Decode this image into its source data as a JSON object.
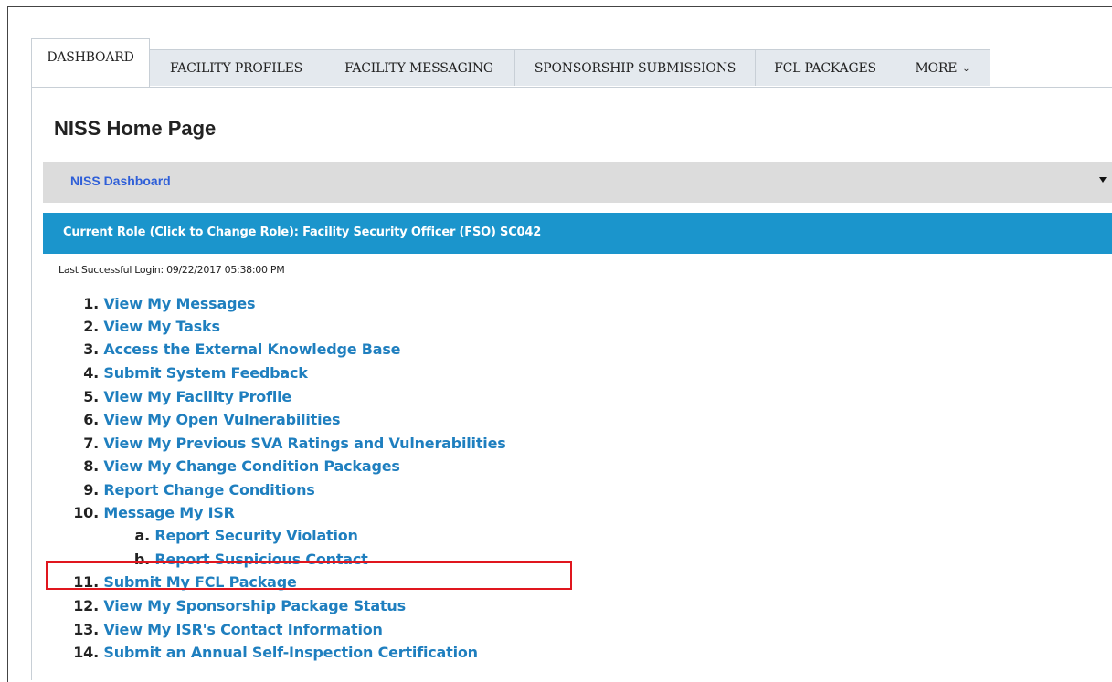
{
  "tabs": [
    {
      "label": "DASHBOARD"
    },
    {
      "label": "FACILITY PROFILES"
    },
    {
      "label": "FACILITY MESSAGING"
    },
    {
      "label": "SPONSORSHIP SUBMISSIONS"
    },
    {
      "label": "FCL PACKAGES"
    },
    {
      "label": "MORE"
    }
  ],
  "page_title": "NISS Home Page",
  "dashboard_label": "NISS Dashboard",
  "role_text": "Current Role (Click to Change Role): Facility Security Officer (FSO) SC042",
  "last_login": "Last Successful Login: 09/22/2017 05:38:00 PM",
  "list_items": [
    {
      "num": "1.",
      "label": "View My Messages"
    },
    {
      "num": "2.",
      "label": "View My Tasks"
    },
    {
      "num": "3.",
      "label": "Access the External Knowledge Base"
    },
    {
      "num": "4.",
      "label": "Submit System Feedback"
    },
    {
      "num": "5.",
      "label": "View My Facility Profile"
    },
    {
      "num": "6.",
      "label": "View My Open Vulnerabilities"
    },
    {
      "num": "7.",
      "label": "View My Previous SVA Ratings and Vulnerabilities"
    },
    {
      "num": "8.",
      "label": "View My Change Condition Packages"
    },
    {
      "num": "9.",
      "label": "Report Change Conditions"
    },
    {
      "num": "10.",
      "label": "Message My ISR"
    },
    {
      "num": "a.",
      "label": "Report Security Violation"
    },
    {
      "num": "b.",
      "label": "Report Suspicious Contact"
    },
    {
      "num": "11.",
      "label": "Submit My FCL Package"
    },
    {
      "num": "12.",
      "label": "View My Sponsorship Package Status"
    },
    {
      "num": "13.",
      "label": "View My ISR's Contact Information"
    },
    {
      "num": "14.",
      "label": "Submit an Annual Self-Inspection Certification"
    }
  ],
  "colors": {
    "role_bar": "#1b95cc",
    "link": "#1f7fbf",
    "highlight": "#e0161e"
  }
}
